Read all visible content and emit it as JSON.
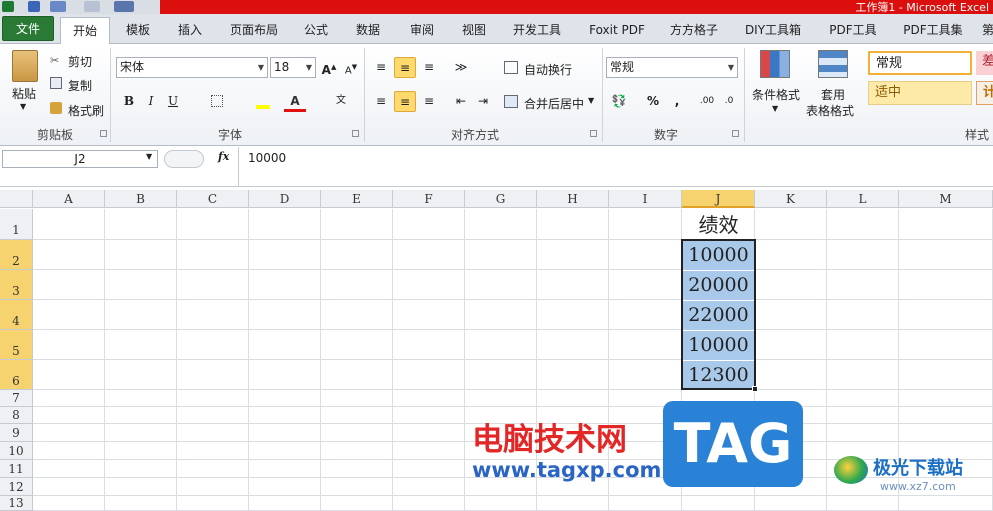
{
  "window": {
    "title": "工作簿1 - Microsoft Excel"
  },
  "tabs": [
    "文件",
    "开始",
    "模板",
    "插入",
    "页面布局",
    "公式",
    "数据",
    "审阅",
    "视图",
    "开发工具",
    "Foxit PDF",
    "方方格子",
    "DIY工具箱",
    "PDF工具",
    "PDF工具集",
    "第"
  ],
  "ribbon": {
    "clipboard": {
      "paste": "粘贴",
      "cut": "剪切",
      "copy": "复制",
      "format_painter": "格式刷",
      "label": "剪贴板"
    },
    "font": {
      "name": "宋体",
      "size": "18",
      "bold": "B",
      "italic": "I",
      "underline": "U",
      "label": "字体"
    },
    "alignment": {
      "wrap": "自动换行",
      "merge": "合并后居中",
      "label": "对齐方式"
    },
    "number": {
      "format": "常规",
      "percent": "%",
      "comma": ",",
      "label": "数字"
    },
    "styles": {
      "conditional": "条件格式",
      "table_format_1": "套用",
      "table_format_2": "表格格式",
      "normal": "常规",
      "bad": "差",
      "neutral": "适中",
      "calc": "计",
      "label": "样式"
    }
  },
  "formula_bar": {
    "name_box": "J2",
    "fx": "fx",
    "value": "10000"
  },
  "columns": [
    "A",
    "B",
    "C",
    "D",
    "E",
    "F",
    "G",
    "H",
    "I",
    "J",
    "K",
    "L",
    "M"
  ],
  "rows": [
    "1",
    "2",
    "3",
    "4",
    "5",
    "6",
    "7",
    "8",
    "9",
    "10",
    "11",
    "12",
    "13"
  ],
  "cells": {
    "J1": "绩效",
    "J2": "10000",
    "J3": "20000",
    "J4": "22000",
    "J5": "10000",
    "J6": "12300"
  },
  "watermarks": {
    "site_cn": "电脑技术网",
    "site_url": "www.tagxp.com",
    "tag": "TAG",
    "right_cn": "极光下载站",
    "right_url": "www.xz7.com"
  },
  "colors": {
    "accent_red": "#dc0f0f",
    "file_tab": "#2a7a36",
    "selection": "#a9c9ea",
    "header_selected": "#f7d36f"
  }
}
